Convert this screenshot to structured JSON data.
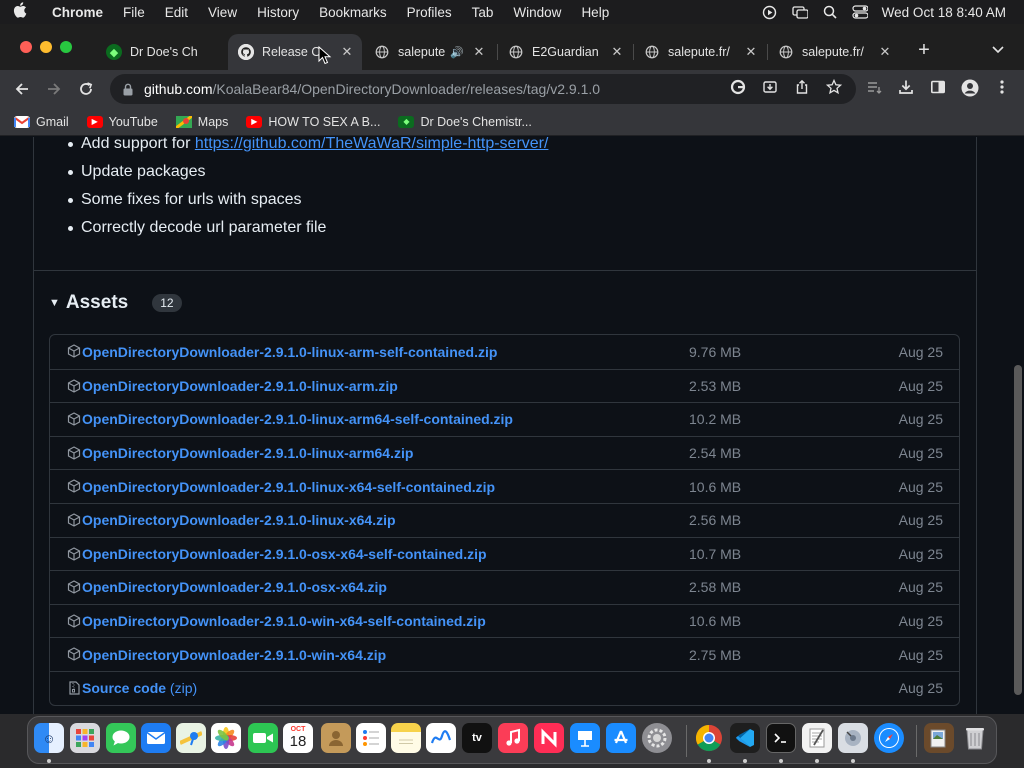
{
  "menubar": {
    "app": "Chrome",
    "items": [
      "File",
      "Edit",
      "View",
      "History",
      "Bookmarks",
      "Profiles",
      "Tab",
      "Window",
      "Help"
    ],
    "clock": "Wed Oct 18  8:40 AM"
  },
  "tabs": [
    {
      "title": "Dr Doe's Ch",
      "active": false
    },
    {
      "title": "Release O",
      "active": true
    },
    {
      "title": "salepute",
      "active": false,
      "audio": true
    },
    {
      "title": "E2Guardian",
      "active": false
    },
    {
      "title": "salepute.fr/",
      "active": false
    },
    {
      "title": "salepute.fr/",
      "active": false
    }
  ],
  "address": {
    "host": "github.com",
    "path": "/KoalaBear84/OpenDirectoryDownloader/releases/tag/v2.9.1.0"
  },
  "bookmarks": [
    {
      "label": "Gmail",
      "icon": "gmail-icon"
    },
    {
      "label": "YouTube",
      "icon": "youtube-icon"
    },
    {
      "label": "Maps",
      "icon": "maps-icon"
    },
    {
      "label": "HOW TO SEX A B...",
      "icon": "youtube-icon"
    },
    {
      "label": "Dr Doe's Chemistr...",
      "icon": "drdoe-icon"
    }
  ],
  "notes": {
    "items": [
      {
        "prefix": "Add support for ",
        "link": "https://github.com/TheWaWaR/simple-http-server/"
      },
      {
        "text": "Update packages"
      },
      {
        "text": "Some fixes for urls with spaces"
      },
      {
        "text": "Correctly decode url parameter file"
      }
    ]
  },
  "assets": {
    "title": "Assets",
    "count": "12",
    "rows": [
      {
        "name": "OpenDirectoryDownloader-2.9.1.0-linux-arm-self-contained.zip",
        "size": "9.76 MB",
        "date": "Aug 25"
      },
      {
        "name": "OpenDirectoryDownloader-2.9.1.0-linux-arm.zip",
        "size": "2.53 MB",
        "date": "Aug 25"
      },
      {
        "name": "OpenDirectoryDownloader-2.9.1.0-linux-arm64-self-contained.zip",
        "size": "10.2 MB",
        "date": "Aug 25"
      },
      {
        "name": "OpenDirectoryDownloader-2.9.1.0-linux-arm64.zip",
        "size": "2.54 MB",
        "date": "Aug 25"
      },
      {
        "name": "OpenDirectoryDownloader-2.9.1.0-linux-x64-self-contained.zip",
        "size": "10.6 MB",
        "date": "Aug 25"
      },
      {
        "name": "OpenDirectoryDownloader-2.9.1.0-linux-x64.zip",
        "size": "2.56 MB",
        "date": "Aug 25"
      },
      {
        "name": "OpenDirectoryDownloader-2.9.1.0-osx-x64-self-contained.zip",
        "size": "10.7 MB",
        "date": "Aug 25"
      },
      {
        "name": "OpenDirectoryDownloader-2.9.1.0-osx-x64.zip",
        "size": "2.58 MB",
        "date": "Aug 25"
      },
      {
        "name": "OpenDirectoryDownloader-2.9.1.0-win-x64-self-contained.zip",
        "size": "10.6 MB",
        "date": "Aug 25"
      },
      {
        "name": "OpenDirectoryDownloader-2.9.1.0-win-x64.zip",
        "size": "2.75 MB",
        "date": "Aug 25"
      },
      {
        "name": "Source code",
        "suffix": "(zip)",
        "size": "",
        "date": "Aug 25",
        "source": true
      }
    ]
  },
  "dock": {
    "apps": [
      "finder-icon",
      "launchpad-icon",
      "messages-icon",
      "mail-icon",
      "maps-icon",
      "photos-icon",
      "facetime-icon",
      "calendar-icon",
      "contacts-icon",
      "reminders-icon",
      "notes-icon",
      "freeform-icon",
      "appletv-icon",
      "music-icon",
      "news-icon",
      "keynote-icon",
      "appstore-icon",
      "systemsettings-icon",
      "chrome-icon",
      "vscode-icon",
      "terminal-icon",
      "textedit-icon",
      "diskutility-icon",
      "safari-icon",
      "preview-icon",
      "trash-icon"
    ],
    "calendar_month": "OCT",
    "calendar_day": "18",
    "tv_label": "tv"
  },
  "colors": {
    "link": "#4493f8",
    "page_bg": "#0d1117",
    "border": "#30363d",
    "muted": "#7d8590"
  }
}
